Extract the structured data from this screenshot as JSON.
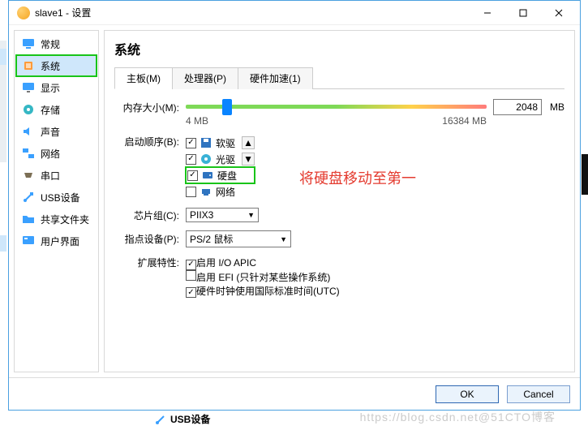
{
  "window": {
    "title": "slave1 - 设置"
  },
  "sidebar": {
    "items": [
      {
        "label": "常规",
        "icon": "monitor"
      },
      {
        "label": "系统",
        "icon": "chip"
      },
      {
        "label": "显示",
        "icon": "display"
      },
      {
        "label": "存储",
        "icon": "disk"
      },
      {
        "label": "声音",
        "icon": "audio"
      },
      {
        "label": "网络",
        "icon": "network"
      },
      {
        "label": "串口",
        "icon": "serial"
      },
      {
        "label": "USB设备",
        "icon": "usb"
      },
      {
        "label": "共享文件夹",
        "icon": "folder"
      },
      {
        "label": "用户界面",
        "icon": "ui"
      }
    ]
  },
  "heading": "系统",
  "tabs": [
    {
      "label": "主板(M)"
    },
    {
      "label": "处理器(P)"
    },
    {
      "label": "硬件加速(1)"
    }
  ],
  "memory": {
    "label": "内存大小(M):",
    "min": "4 MB",
    "max": "16384 MB",
    "value": "2048",
    "unit": "MB",
    "percent": 12
  },
  "boot": {
    "label": "启动顺序(B):",
    "items": [
      {
        "label": "软驱",
        "checked": true,
        "icon": "floppy"
      },
      {
        "label": "光驱",
        "checked": true,
        "icon": "optical"
      },
      {
        "label": "硬盘",
        "checked": true,
        "icon": "hdd"
      },
      {
        "label": "网络",
        "checked": false,
        "icon": "net"
      }
    ]
  },
  "annotation": "将硬盘移动至第一",
  "chipset": {
    "label": "芯片组(C):",
    "value": "PIIX3"
  },
  "pointer": {
    "label": "指点设备(P):",
    "value": "PS/2 鼠标"
  },
  "ext": {
    "label": "扩展特性:",
    "opts": [
      {
        "label": "启用 I/O APIC",
        "checked": true
      },
      {
        "label": "启用 EFI (只针对某些操作系统)",
        "checked": false
      },
      {
        "label": "硬件时钟使用国际标准时间(UTC)",
        "checked": true
      }
    ]
  },
  "buttons": {
    "ok": "OK",
    "cancel": "Cancel"
  },
  "watermark": "https://blog.csdn.net@51CTO博客",
  "truncated": "USB设备"
}
